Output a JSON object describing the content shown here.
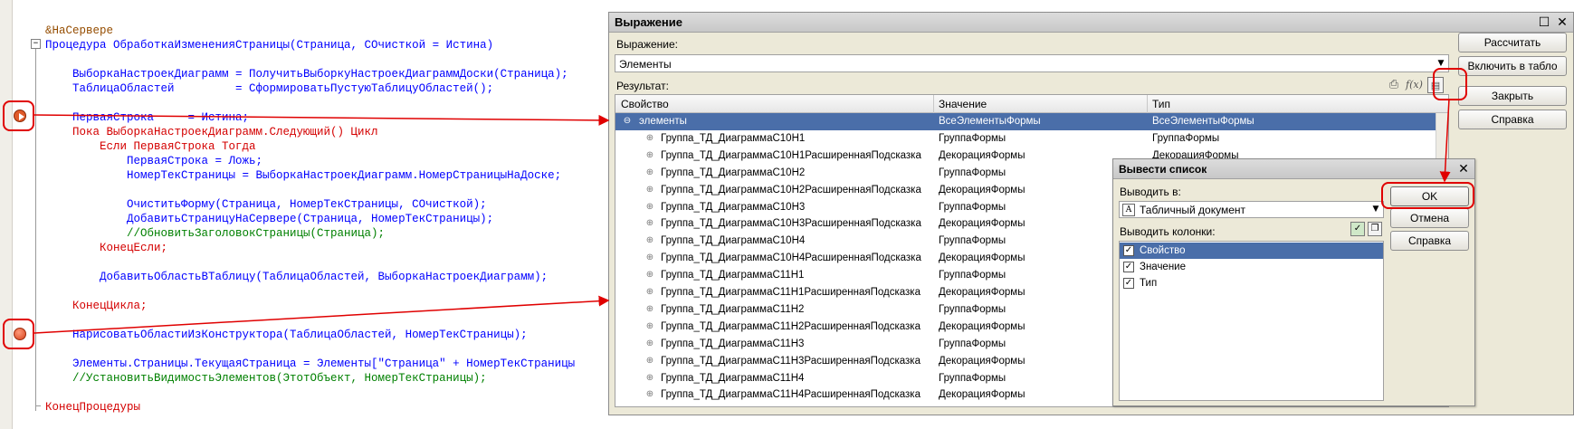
{
  "editor": {
    "lines": [
      {
        "text": "&НаСервере",
        "cls": "c-dir"
      },
      {
        "text": "Процедура ОбработкаИзмененияСтраницы(Страница, СОчисткой = Истина)",
        "cls": "c-id"
      },
      {
        "text": "",
        "cls": "c-id"
      },
      {
        "text": "    ВыборкаНастроекДиаграмм = ПолучитьВыборкуНастроекДиаграммДоски(Страница);",
        "cls": "c-id"
      },
      {
        "text": "    ТаблицаОбластей         = СформироватьПустуюТаблицуОбластей();",
        "cls": "c-id"
      },
      {
        "text": "",
        "cls": "c-id"
      },
      {
        "text": "    ПерваяСтрока     = Истина;",
        "cls": "c-id"
      },
      {
        "text": "    Пока ВыборкаНастроекДиаграмм.Следующий() Цикл",
        "cls": "c-kw"
      },
      {
        "text": "        Если ПерваяСтрока Тогда",
        "cls": "c-kw"
      },
      {
        "text": "            ПерваяСтрока = Ложь;",
        "cls": "c-id"
      },
      {
        "text": "            НомерТекСтраницы = ВыборкаНастроекДиаграмм.НомерСтраницыНаДоске;",
        "cls": "c-id"
      },
      {
        "text": "",
        "cls": "c-id"
      },
      {
        "text": "            ОчиститьФорму(Страница, НомерТекСтраницы, СОчисткой);",
        "cls": "c-id"
      },
      {
        "text": "            ДобавитьСтраницуНаСервере(Страница, НомерТекСтраницы);",
        "cls": "c-id"
      },
      {
        "text": "            //ОбновитьЗаголовокСтраницы(Страница);",
        "cls": "c-com"
      },
      {
        "text": "        КонецЕсли;",
        "cls": "c-kw"
      },
      {
        "text": "",
        "cls": "c-id"
      },
      {
        "text": "        ДобавитьОбластьВТаблицу(ТаблицаОбластей, ВыборкаНастроекДиаграмм);",
        "cls": "c-id"
      },
      {
        "text": "",
        "cls": "c-id"
      },
      {
        "text": "    КонецЦикла;",
        "cls": "c-kw"
      },
      {
        "text": "",
        "cls": "c-id"
      },
      {
        "text": "    НарисоватьОбластиИзКонструктора(ТаблицаОбластей, НомерТекСтраницы);",
        "cls": "c-id"
      },
      {
        "text": "",
        "cls": "c-id"
      },
      {
        "text": "    Элементы.Страницы.ТекущаяСтраница = Элементы[\"Страница\" + НомерТекСтраницы",
        "cls": "c-id"
      },
      {
        "text": "    //УстановитьВидимостьЭлементов(ЭтотОбъект, НомерТекСтраницы);",
        "cls": "c-com"
      },
      {
        "text": "",
        "cls": "c-id"
      },
      {
        "text": "КонецПроцедуры",
        "cls": "c-kw"
      }
    ]
  },
  "expression_dialog": {
    "title": "Выражение",
    "expression_label": "Выражение:",
    "expression_value": "Элементы",
    "result_label": "Результат:",
    "fx_label": "f(x)",
    "columns": [
      "Свойство",
      "Значение",
      "Тип"
    ],
    "rows": [
      {
        "name": "элементы",
        "value": "ВсеЭлементыФормы",
        "type": "ВсеЭлементыФормы",
        "selected": true,
        "root": true
      },
      {
        "name": "Группа_ТД_ДиаграммаС10Н1",
        "value": "ГруппаФормы",
        "type": "ГруппаФормы"
      },
      {
        "name": "Группа_ТД_ДиаграммаС10Н1РасширеннаяПодсказка",
        "value": "ДекорацияФормы",
        "type": "ДекорацияФормы"
      },
      {
        "name": "Группа_ТД_ДиаграммаС10Н2",
        "value": "ГруппаФормы",
        "type": ""
      },
      {
        "name": "Группа_ТД_ДиаграммаС10Н2РасширеннаяПодсказка",
        "value": "ДекорацияФормы",
        "type": ""
      },
      {
        "name": "Группа_ТД_ДиаграммаС10Н3",
        "value": "ГруппаФормы",
        "type": ""
      },
      {
        "name": "Группа_ТД_ДиаграммаС10Н3РасширеннаяПодсказка",
        "value": "ДекорацияФормы",
        "type": ""
      },
      {
        "name": "Группа_ТД_ДиаграммаС10Н4",
        "value": "ГруппаФормы",
        "type": ""
      },
      {
        "name": "Группа_ТД_ДиаграммаС10Н4РасширеннаяПодсказка",
        "value": "ДекорацияФормы",
        "type": ""
      },
      {
        "name": "Группа_ТД_ДиаграммаС11Н1",
        "value": "ГруппаФормы",
        "type": ""
      },
      {
        "name": "Группа_ТД_ДиаграммаС11Н1РасширеннаяПодсказка",
        "value": "ДекорацияФормы",
        "type": ""
      },
      {
        "name": "Группа_ТД_ДиаграммаС11Н2",
        "value": "ГруппаФормы",
        "type": ""
      },
      {
        "name": "Группа_ТД_ДиаграммаС11Н2РасширеннаяПодсказка",
        "value": "ДекорацияФормы",
        "type": ""
      },
      {
        "name": "Группа_ТД_ДиаграммаС11Н3",
        "value": "ГруппаФормы",
        "type": ""
      },
      {
        "name": "Группа_ТД_ДиаграммаС11Н3РасширеннаяПодсказка",
        "value": "ДекорацияФормы",
        "type": ""
      },
      {
        "name": "Группа_ТД_ДиаграммаС11Н4",
        "value": "ГруппаФормы",
        "type": ""
      },
      {
        "name": "Группа_ТД_ДиаграммаС11Н4РасширеннаяПодсказка",
        "value": "ДекорацияФормы",
        "type": ""
      }
    ],
    "buttons": {
      "calculate": "Рассчитать",
      "add_to_board": "Включить в табло",
      "close": "Закрыть",
      "help": "Справка"
    }
  },
  "list_dialog": {
    "title": "Вывести список",
    "output_label": "Выводить в:",
    "output_value": "Табличный документ",
    "columns_label": "Выводить колонки:",
    "columns": [
      {
        "label": "Свойство",
        "checked": true,
        "selected": true
      },
      {
        "label": "Значение",
        "checked": true,
        "selected": false
      },
      {
        "label": "Тип",
        "checked": true,
        "selected": false
      }
    ],
    "buttons": {
      "ok": "OK",
      "cancel": "Отмена",
      "help": "Справка"
    }
  },
  "colors": {
    "selection": "#4a6ea9",
    "highlight": "#e00000",
    "dialog_bg": "#ece9d8"
  }
}
